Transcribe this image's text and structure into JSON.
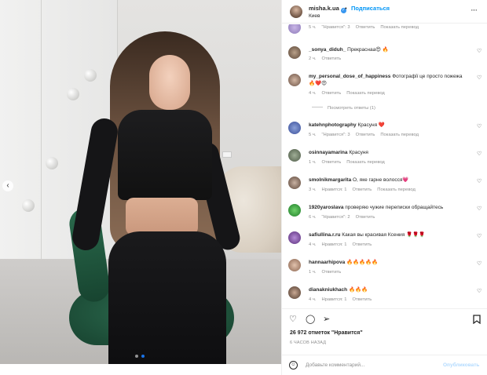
{
  "header": {
    "username": "misha.k.ua",
    "verified_icon": "verified-badge-icon",
    "separator": "•",
    "follow_label": "Подписаться",
    "location": "Киев",
    "more_icon": "more-options-icon"
  },
  "photo": {
    "prev_icon": "chevron-left-icon",
    "carousel_current": 2,
    "carousel_total": 2
  },
  "comments": [
    {
      "username": "",
      "text": "",
      "time": "5 ч.",
      "likes": "\"Нравится\": 3",
      "reply": "Ответить",
      "translate": "Показать перевод"
    },
    {
      "username": "_sonya_diduh_",
      "text": "Прекраснаа😍 🔥",
      "time": "2 ч.",
      "likes": "",
      "reply": "Ответить",
      "translate": ""
    },
    {
      "username": "my_personal_dose_of_happiness",
      "text": "Фотографії це просто пожежа 🔥❤️😍",
      "time": "4 ч.",
      "likes": "",
      "reply": "Ответить",
      "translate": "Показать перевод"
    },
    {
      "username": "katehnphotography",
      "text": "Красуня ❤️",
      "time": "5 ч.",
      "likes": "\"Нравится\": 3",
      "reply": "Ответить",
      "translate": "Показать перевод"
    },
    {
      "username": "osinnayamarina",
      "text": "Красуня",
      "time": "1 ч.",
      "likes": "",
      "reply": "Ответить",
      "translate": "Показать перевод"
    },
    {
      "username": "smolnikmargarita",
      "text": "О, яке гарне волосся💗",
      "time": "3 ч.",
      "likes": "Нравится: 1",
      "reply": "Ответить",
      "translate": "Показать перевод"
    },
    {
      "username": "1920yaroslava",
      "text": "проверяю чужие переписки обращайтесь",
      "time": "6 ч.",
      "likes": "\"Нравится\": 2",
      "reply": "Ответить",
      "translate": ""
    },
    {
      "username": "safiullina.r.ru",
      "text": "Какая вы красивая Ксения 🌹🌹🌹",
      "time": "4 ч.",
      "likes": "Нравится: 1",
      "reply": "Ответить",
      "translate": ""
    },
    {
      "username": "hannaarhipova",
      "text": "🔥🔥🔥🔥🔥",
      "time": "1 ч.",
      "likes": "",
      "reply": "Ответить",
      "translate": ""
    },
    {
      "username": "dianakniukhach",
      "text": "🔥🔥🔥",
      "time": "4 ч.",
      "likes": "Нравится: 1",
      "reply": "Ответить",
      "translate": ""
    }
  ],
  "view_replies": "Посмотреть ответы (1)",
  "actions": {
    "like_icon": "heart-icon",
    "comment_icon": "comment-icon",
    "share_icon": "share-icon",
    "save_icon": "bookmark-icon"
  },
  "likes_count": "26 972 отметок \"Нравится\"",
  "posted_time": "6 ЧАСОВ НАЗАД",
  "add_comment": {
    "emoji_icon": "emoji-icon",
    "placeholder": "Добавьте комментарий...",
    "post_label": "Опубликовать"
  },
  "colors": {
    "link": "#0095f6",
    "muted": "#8e8e8e",
    "text": "#262626",
    "post_disabled": "#b3dbff"
  }
}
